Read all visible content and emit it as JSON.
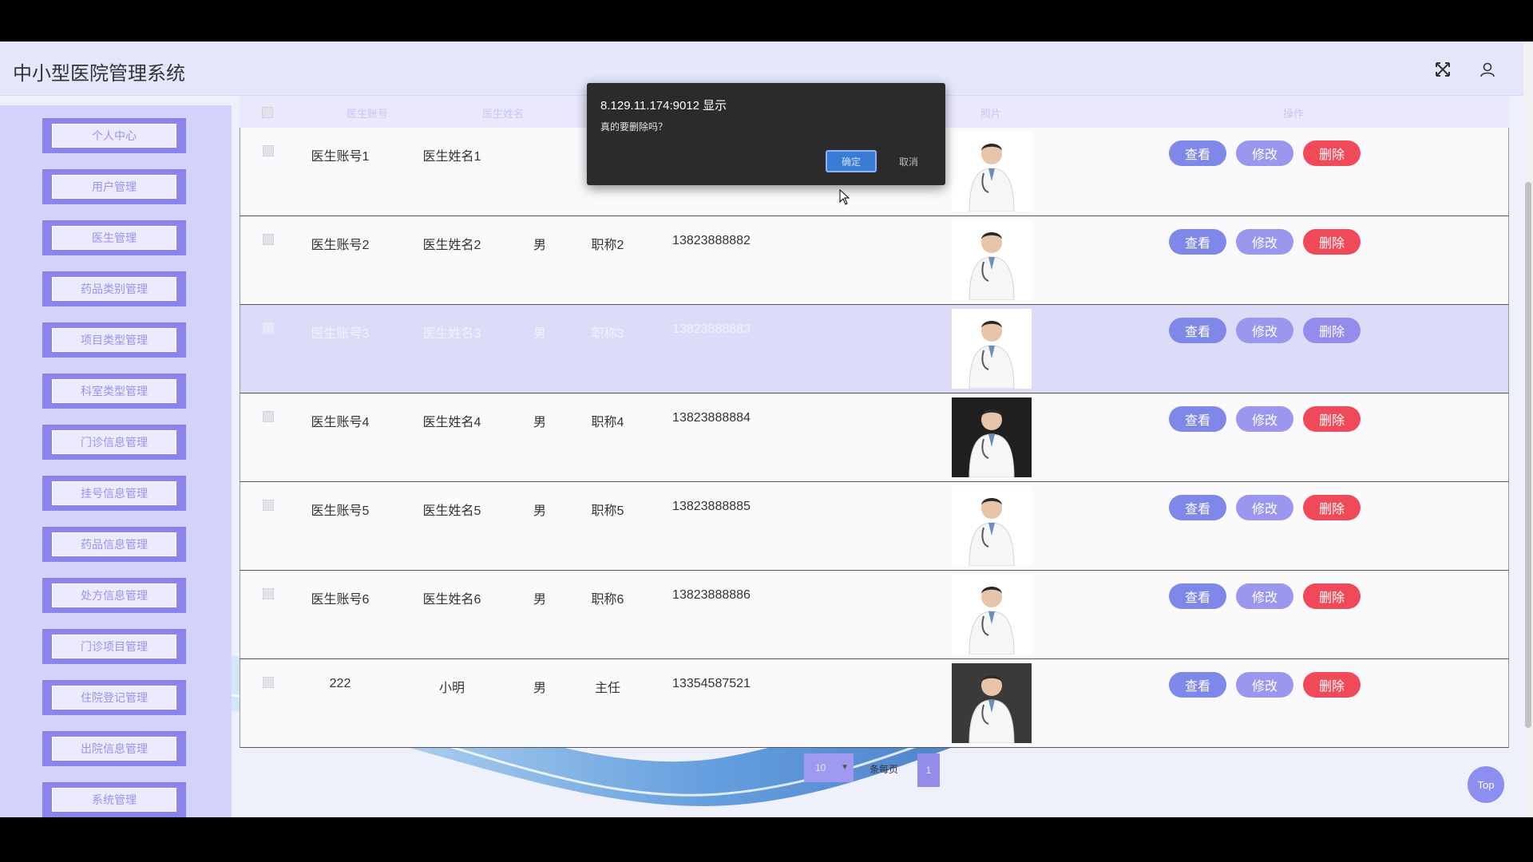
{
  "app": {
    "title": "中小型医院管理系统"
  },
  "topbar": {
    "fullscreen_icon": "expand-icon",
    "user_icon": "user-icon"
  },
  "sidebar": {
    "items": [
      {
        "label": "个人中心"
      },
      {
        "label": "用户管理"
      },
      {
        "label": "医生管理"
      },
      {
        "label": "药品类别管理"
      },
      {
        "label": "项目类型管理"
      },
      {
        "label": "科室类型管理"
      },
      {
        "label": "门诊信息管理"
      },
      {
        "label": "挂号信息管理"
      },
      {
        "label": "药品信息管理"
      },
      {
        "label": "处方信息管理"
      },
      {
        "label": "门诊项目管理"
      },
      {
        "label": "住院登记管理"
      },
      {
        "label": "出院信息管理"
      },
      {
        "label": "系统管理"
      }
    ]
  },
  "table": {
    "headers": {
      "account": "医生账号",
      "name": "医生姓名",
      "photo": "照片",
      "actions": "操作"
    },
    "rows": [
      {
        "account": "医生账号1",
        "name": "医生姓名1",
        "gender": "",
        "title": "",
        "phone": "",
        "highlighted": false
      },
      {
        "account": "医生账号2",
        "name": "医生姓名2",
        "gender": "男",
        "title": "职称2",
        "phone": "13823888882",
        "highlighted": false
      },
      {
        "account": "医生账号3",
        "name": "医生姓名3",
        "gender": "男",
        "title": "职称3",
        "phone": "13823888883",
        "highlighted": true
      },
      {
        "account": "医生账号4",
        "name": "医生姓名4",
        "gender": "男",
        "title": "职称4",
        "phone": "13823888884",
        "highlighted": false
      },
      {
        "account": "医生账号5",
        "name": "医生姓名5",
        "gender": "男",
        "title": "职称5",
        "phone": "13823888885",
        "highlighted": false
      },
      {
        "account": "医生账号6",
        "name": "医生姓名6",
        "gender": "男",
        "title": "职称6",
        "phone": "13823888886",
        "highlighted": false
      },
      {
        "account": "222",
        "name": "小明",
        "gender": "男",
        "title": "主任",
        "phone": "13354587521",
        "highlighted": false
      }
    ],
    "actions": {
      "view": "查看",
      "edit": "修改",
      "delete": "删除"
    }
  },
  "pagination": {
    "page_size": "10",
    "per_page_label": "条每页",
    "current_page": "1"
  },
  "top_button": {
    "label": "Top"
  },
  "dialog": {
    "origin": "8.129.11.174:9012 显示",
    "message": "真的要删除吗？",
    "ok_label": "确定",
    "cancel_label": "取消"
  },
  "colors": {
    "accent": "#8a84ec",
    "view_button": "#7f87e8",
    "edit_button": "#9c97ee",
    "delete_button": "#f04a5a",
    "dialog_bg": "#2b2b2b"
  }
}
